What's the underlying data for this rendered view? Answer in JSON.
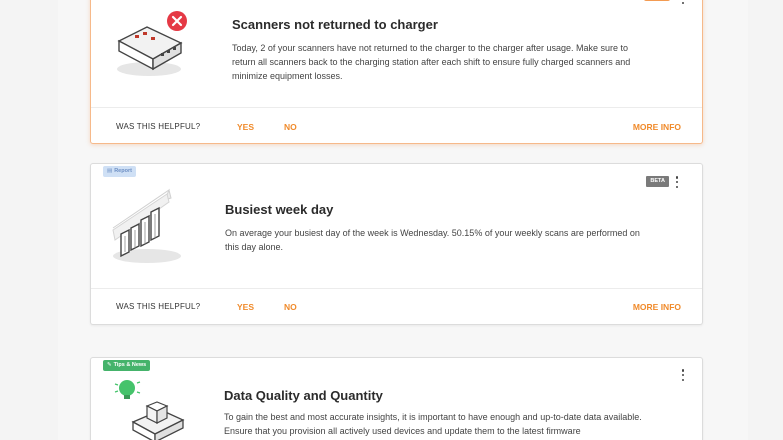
{
  "cards": [
    {
      "title": "Scanners not returned to charger",
      "body": "Today, 2 of your scanners have not returned to the charger to the charger after usage. Make sure to return all scanners back to the charging station after each shift to ensure fully charged scanners and minimize equipment losses.",
      "helpful_label": "WAS THIS HELPFUL?",
      "yes_label": "YES",
      "no_label": "NO",
      "more_info_label": "MORE INFO",
      "icon": "scanner-error-icon"
    },
    {
      "tag": "Report",
      "badge": "BETA",
      "title": "Busiest week day",
      "body": "On average your busiest day of the week is Wednesday. 50.15% of your weekly scans are performed on this day alone.",
      "helpful_label": "WAS THIS HELPFUL?",
      "yes_label": "YES",
      "no_label": "NO",
      "more_info_label": "MORE INFO",
      "icon": "bar-chart-growth-icon"
    },
    {
      "tag": "Tips & News",
      "title": "Data Quality and Quantity",
      "body": "To gain the best and most accurate insights, it is important to have enough and up-to-date data available. Ensure that you provision all actively used devices and update them to the latest firmware",
      "icon": "lightbulb-boxes-icon"
    }
  ],
  "colors": {
    "accent": "#f08a2a",
    "alert_border": "#f6b98a",
    "error_red": "#e53945",
    "tips_green": "#45b36b",
    "report_tag": "#cfe0f5"
  }
}
